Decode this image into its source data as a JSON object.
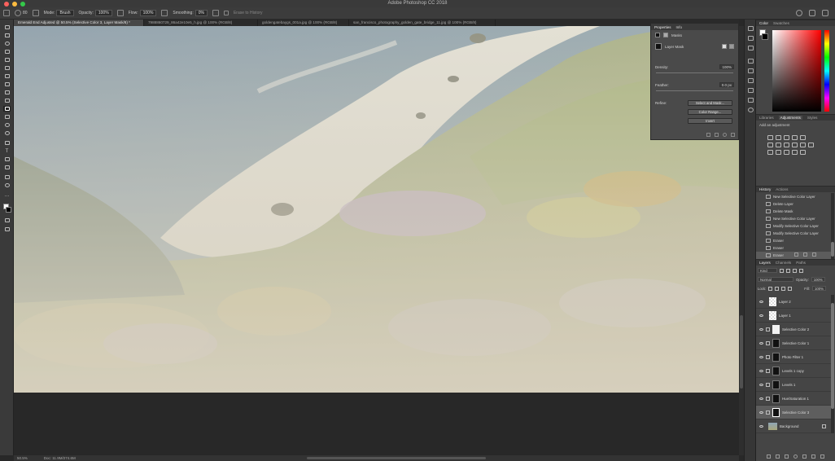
{
  "window": {
    "title": "Adobe Photoshop CC 2018",
    "traffic_colors": [
      "#fc615d",
      "#fdbc40",
      "#34c84a"
    ]
  },
  "options_bar": {
    "brush_size": "80",
    "mode_label": "Mode:",
    "mode_value": "Brush",
    "opacity_label": "Opacity:",
    "opacity_value": "100%",
    "flow_label": "Flow:",
    "flow_value": "100%",
    "smoothing_label": "Smoothing:",
    "smoothing_value": "0%",
    "history_btn": "Erase to History"
  },
  "tabs": [
    {
      "label": "Emerald End Adjusted @ 50.5% (Selective Color 3, Layer Mask/8) *",
      "active": true
    },
    {
      "label": "7988860729_86a42e10e5_h.jpg @ 100% (RGB/8)",
      "active": false
    },
    {
      "label": "goldengatebaygs_001a.jpg @ 100% (RGB/8)",
      "active": false
    },
    {
      "label": "san_francisco_photography_golden_gate_bridge_11.jpg @ 100% (RGB/8)",
      "active": false
    }
  ],
  "status": {
    "zoom": "50.5%",
    "doc": "Doc: 11.9M/274.6M"
  },
  "properties": {
    "tab1": "Properties",
    "tab2": "Info",
    "masks_label": "Masks",
    "layer_mask_label": "Layer Mask",
    "density_label": "Density:",
    "density_value": "100%",
    "feather_label": "Feather:",
    "feather_value": "0.0 px",
    "refine_label": "Refine:",
    "select_mask_btn": "Select and Mask...",
    "color_range_btn": "Color Range...",
    "invert_btn": "Invert"
  },
  "color_panel": {
    "tab1": "Color",
    "tab2": "Swatches"
  },
  "adjust_panel": {
    "tab1": "Libraries",
    "tab2": "Adjustments",
    "tab3": "Styles",
    "add_label": "Add an adjustment"
  },
  "history_panel": {
    "tab1": "History",
    "tab2": "Actions",
    "items": [
      {
        "label": "New Selective Color Layer",
        "selected": false
      },
      {
        "label": "Delete Layer",
        "selected": false
      },
      {
        "label": "Delete Mask",
        "selected": false
      },
      {
        "label": "New Selective Color Layer",
        "selected": false
      },
      {
        "label": "Modify Selective Color Layer",
        "selected": false
      },
      {
        "label": "Modify Selective Color Layer",
        "selected": false
      },
      {
        "label": "Eraser",
        "selected": false
      },
      {
        "label": "Eraser",
        "selected": false
      },
      {
        "label": "Eraser",
        "selected": true
      }
    ]
  },
  "layers_panel": {
    "tab1": "Layers",
    "tab2": "Channels",
    "tab3": "Paths",
    "kind_label": "Kind",
    "blend_mode": "Normal",
    "opacity_label": "Opacity:",
    "opacity_value": "100%",
    "lock_label": "Lock:",
    "fill_label": "Fill:",
    "fill_value": "100%",
    "layers": [
      {
        "name": "Layer 2",
        "type": "pixel",
        "selected": false
      },
      {
        "name": "Layer 1",
        "type": "pixel",
        "selected": false
      },
      {
        "name": "Selective Color 2",
        "type": "adj-white",
        "selected": false
      },
      {
        "name": "Selective Color 1",
        "type": "adj-black",
        "selected": false
      },
      {
        "name": "Photo Filter 1",
        "type": "adj-black",
        "selected": false
      },
      {
        "name": "Levels 1 copy",
        "type": "adj-black",
        "selected": false
      },
      {
        "name": "Levels 1",
        "type": "adj-black",
        "selected": false
      },
      {
        "name": "Hue/Saturation 1",
        "type": "adj-black",
        "selected": false
      },
      {
        "name": "Selective Color 3",
        "type": "adj-black",
        "selected": true
      },
      {
        "name": "Background",
        "type": "image",
        "selected": false
      }
    ]
  }
}
